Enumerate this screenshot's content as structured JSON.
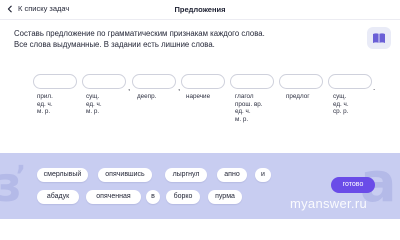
{
  "header": {
    "back_label": "К списку задач",
    "title": "Предложения"
  },
  "task": {
    "line1": "Составь предложение по грамматическим признакам каждого слова.",
    "line2": "Все слова выдуманные. В задании есть лишние слова."
  },
  "icons": {
    "back": "chevron-left-icon",
    "hint": "book-icon"
  },
  "slots": [
    {
      "lines": [
        "прил.",
        "ед. ч.",
        "м. р."
      ]
    },
    {
      "lines": [
        "сущ.",
        "ед. ч.",
        "м. р."
      ]
    },
    {
      "lines": [
        "деепр."
      ]
    },
    {
      "lines": [
        "наречие"
      ]
    },
    {
      "lines": [
        "глагол",
        "прош. вр.",
        "ед. ч.",
        "м. р."
      ]
    },
    {
      "lines": [
        "предлог"
      ]
    },
    {
      "lines": [
        "сущ.",
        "ед. ч.",
        "ср. р."
      ]
    }
  ],
  "punctuation": [
    ",",
    ",",
    "."
  ],
  "word_bank": {
    "row1": [
      "смерлывый",
      "опячившись",
      "лыргнул",
      "апно",
      "и"
    ],
    "row2": [
      "абадук",
      "опяченная",
      "в",
      "борко",
      "пурма"
    ]
  },
  "done_label": "готово",
  "watermark": "myanswer.ru",
  "colors": {
    "accent": "#6a4ce8",
    "panel": "#c8cdf1",
    "hint_bg": "#e9ebf7"
  }
}
